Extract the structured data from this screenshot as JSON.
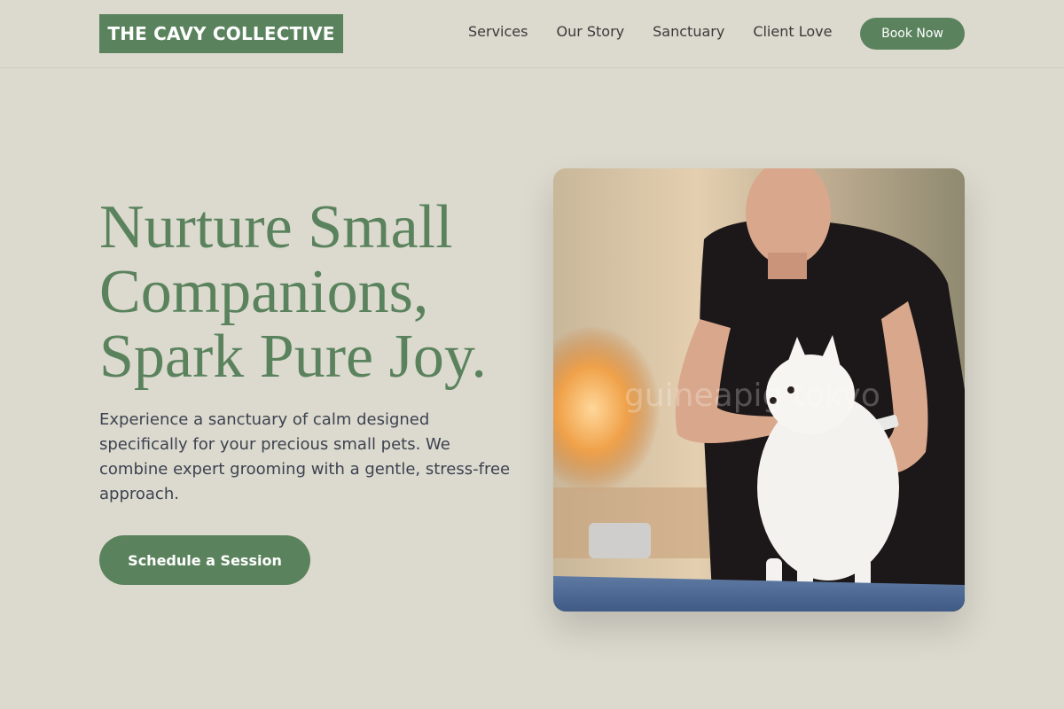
{
  "brand": {
    "name": "THE CAVY COLLECTIVE",
    "color": "#5a835d"
  },
  "nav": {
    "items": [
      {
        "label": "Services"
      },
      {
        "label": "Our Story"
      },
      {
        "label": "Sanctuary"
      },
      {
        "label": "Client Love"
      }
    ],
    "cta_label": "Book Now"
  },
  "hero": {
    "headline_lines": [
      "Nurture Small",
      "Companions,",
      "Spark Pure Joy."
    ],
    "description": "Experience a sanctuary of calm designed specifically for your precious small pets. We combine expert grooming with a gentle, stress-free approach.",
    "cta_label": "Schedule a Session",
    "image_subject": "groomer-combing-white-pomeranian",
    "image_watermark": "guineapig tokyo"
  },
  "colors": {
    "background": "#dcd9ce",
    "accent": "#5a835d",
    "text": "#3c4350"
  }
}
